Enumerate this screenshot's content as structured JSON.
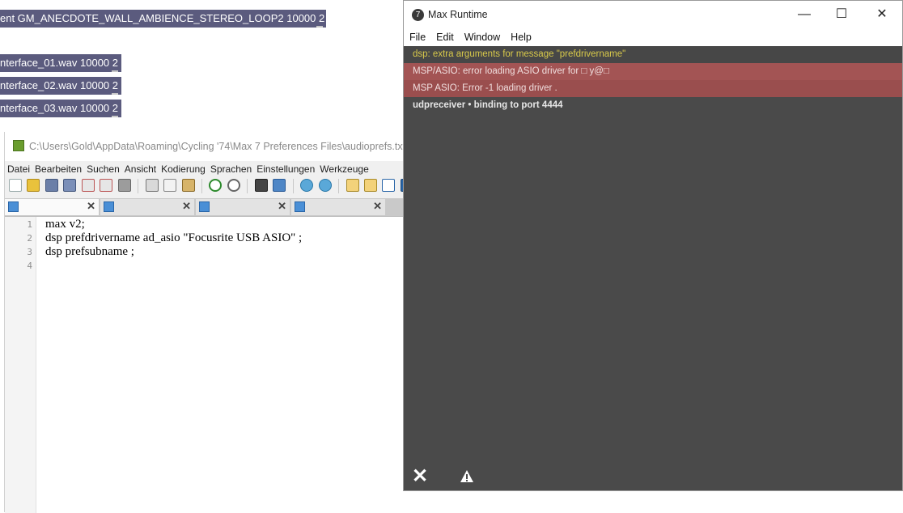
{
  "max_boxes": [
    {
      "text": "ent GM_ANECDOTE_WALL_AMBIENCE_STEREO_LOOP2 10000 2"
    },
    {
      "text": "nterface_01.wav 10000 2"
    },
    {
      "text": "nterface_02.wav 10000 2"
    },
    {
      "text": "nterface_03.wav 10000 2"
    }
  ],
  "notepad": {
    "title": "C:\\Users\\Gold\\AppData\\Roaming\\Cycling '74\\Max 7 Preferences Files\\audioprefs.txt",
    "menu": [
      "Datei",
      "Bearbeiten",
      "Suchen",
      "Ansicht",
      "Kodierung",
      "Sprachen",
      "Einstellungen",
      "Werkzeuge"
    ],
    "lines": [
      {
        "num": "1",
        "code": "max v2;"
      },
      {
        "num": "2",
        "code": "dsp prefdrivername ad_asio \"Focusrite USB ASIO\" ;"
      },
      {
        "num": "3",
        "code": "dsp prefsubname ;"
      },
      {
        "num": "4",
        "code": ""
      }
    ]
  },
  "max_window": {
    "title": "Max Runtime",
    "logo_glyph": "7",
    "controls": {
      "minimize": "—",
      "maximize": "☐",
      "close": "✕"
    },
    "menu": [
      "File",
      "Edit",
      "Window",
      "Help"
    ],
    "console": [
      {
        "kind": "warn",
        "source": "",
        "text": "dsp: extra arguments for message \"prefdrivername\""
      },
      {
        "kind": "err",
        "source": "",
        "text": "MSP/ASIO: error loading ASIO driver for □ y@□"
      },
      {
        "kind": "err2",
        "source": "",
        "text": "MSP ASIO: Error -1 loading driver ."
      },
      {
        "kind": "info",
        "source": "udpreceiver",
        "text": "binding to port 4444"
      }
    ],
    "clear_glyph": "✕"
  }
}
